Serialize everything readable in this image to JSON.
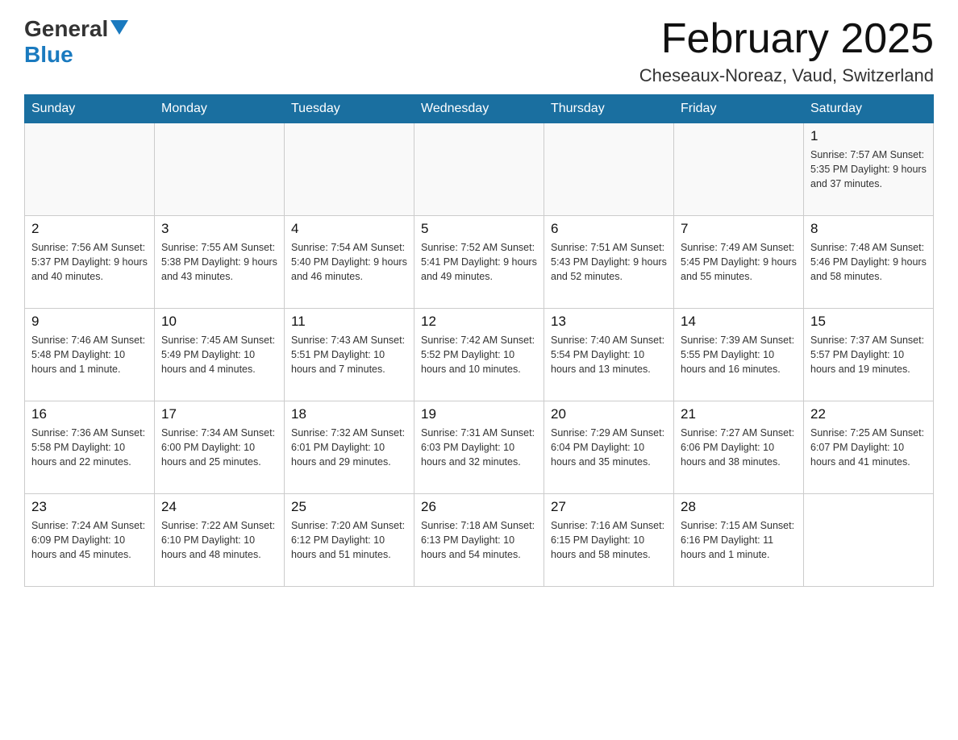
{
  "header": {
    "logo_general": "General",
    "logo_blue": "Blue",
    "title": "February 2025",
    "subtitle": "Cheseaux-Noreaz, Vaud, Switzerland"
  },
  "columns": [
    "Sunday",
    "Monday",
    "Tuesday",
    "Wednesday",
    "Thursday",
    "Friday",
    "Saturday"
  ],
  "weeks": [
    [
      {
        "day": "",
        "info": ""
      },
      {
        "day": "",
        "info": ""
      },
      {
        "day": "",
        "info": ""
      },
      {
        "day": "",
        "info": ""
      },
      {
        "day": "",
        "info": ""
      },
      {
        "day": "",
        "info": ""
      },
      {
        "day": "1",
        "info": "Sunrise: 7:57 AM\nSunset: 5:35 PM\nDaylight: 9 hours\nand 37 minutes."
      }
    ],
    [
      {
        "day": "2",
        "info": "Sunrise: 7:56 AM\nSunset: 5:37 PM\nDaylight: 9 hours\nand 40 minutes."
      },
      {
        "day": "3",
        "info": "Sunrise: 7:55 AM\nSunset: 5:38 PM\nDaylight: 9 hours\nand 43 minutes."
      },
      {
        "day": "4",
        "info": "Sunrise: 7:54 AM\nSunset: 5:40 PM\nDaylight: 9 hours\nand 46 minutes."
      },
      {
        "day": "5",
        "info": "Sunrise: 7:52 AM\nSunset: 5:41 PM\nDaylight: 9 hours\nand 49 minutes."
      },
      {
        "day": "6",
        "info": "Sunrise: 7:51 AM\nSunset: 5:43 PM\nDaylight: 9 hours\nand 52 minutes."
      },
      {
        "day": "7",
        "info": "Sunrise: 7:49 AM\nSunset: 5:45 PM\nDaylight: 9 hours\nand 55 minutes."
      },
      {
        "day": "8",
        "info": "Sunrise: 7:48 AM\nSunset: 5:46 PM\nDaylight: 9 hours\nand 58 minutes."
      }
    ],
    [
      {
        "day": "9",
        "info": "Sunrise: 7:46 AM\nSunset: 5:48 PM\nDaylight: 10 hours\nand 1 minute."
      },
      {
        "day": "10",
        "info": "Sunrise: 7:45 AM\nSunset: 5:49 PM\nDaylight: 10 hours\nand 4 minutes."
      },
      {
        "day": "11",
        "info": "Sunrise: 7:43 AM\nSunset: 5:51 PM\nDaylight: 10 hours\nand 7 minutes."
      },
      {
        "day": "12",
        "info": "Sunrise: 7:42 AM\nSunset: 5:52 PM\nDaylight: 10 hours\nand 10 minutes."
      },
      {
        "day": "13",
        "info": "Sunrise: 7:40 AM\nSunset: 5:54 PM\nDaylight: 10 hours\nand 13 minutes."
      },
      {
        "day": "14",
        "info": "Sunrise: 7:39 AM\nSunset: 5:55 PM\nDaylight: 10 hours\nand 16 minutes."
      },
      {
        "day": "15",
        "info": "Sunrise: 7:37 AM\nSunset: 5:57 PM\nDaylight: 10 hours\nand 19 minutes."
      }
    ],
    [
      {
        "day": "16",
        "info": "Sunrise: 7:36 AM\nSunset: 5:58 PM\nDaylight: 10 hours\nand 22 minutes."
      },
      {
        "day": "17",
        "info": "Sunrise: 7:34 AM\nSunset: 6:00 PM\nDaylight: 10 hours\nand 25 minutes."
      },
      {
        "day": "18",
        "info": "Sunrise: 7:32 AM\nSunset: 6:01 PM\nDaylight: 10 hours\nand 29 minutes."
      },
      {
        "day": "19",
        "info": "Sunrise: 7:31 AM\nSunset: 6:03 PM\nDaylight: 10 hours\nand 32 minutes."
      },
      {
        "day": "20",
        "info": "Sunrise: 7:29 AM\nSunset: 6:04 PM\nDaylight: 10 hours\nand 35 minutes."
      },
      {
        "day": "21",
        "info": "Sunrise: 7:27 AM\nSunset: 6:06 PM\nDaylight: 10 hours\nand 38 minutes."
      },
      {
        "day": "22",
        "info": "Sunrise: 7:25 AM\nSunset: 6:07 PM\nDaylight: 10 hours\nand 41 minutes."
      }
    ],
    [
      {
        "day": "23",
        "info": "Sunrise: 7:24 AM\nSunset: 6:09 PM\nDaylight: 10 hours\nand 45 minutes."
      },
      {
        "day": "24",
        "info": "Sunrise: 7:22 AM\nSunset: 6:10 PM\nDaylight: 10 hours\nand 48 minutes."
      },
      {
        "day": "25",
        "info": "Sunrise: 7:20 AM\nSunset: 6:12 PM\nDaylight: 10 hours\nand 51 minutes."
      },
      {
        "day": "26",
        "info": "Sunrise: 7:18 AM\nSunset: 6:13 PM\nDaylight: 10 hours\nand 54 minutes."
      },
      {
        "day": "27",
        "info": "Sunrise: 7:16 AM\nSunset: 6:15 PM\nDaylight: 10 hours\nand 58 minutes."
      },
      {
        "day": "28",
        "info": "Sunrise: 7:15 AM\nSunset: 6:16 PM\nDaylight: 11 hours\nand 1 minute."
      },
      {
        "day": "",
        "info": ""
      }
    ]
  ]
}
